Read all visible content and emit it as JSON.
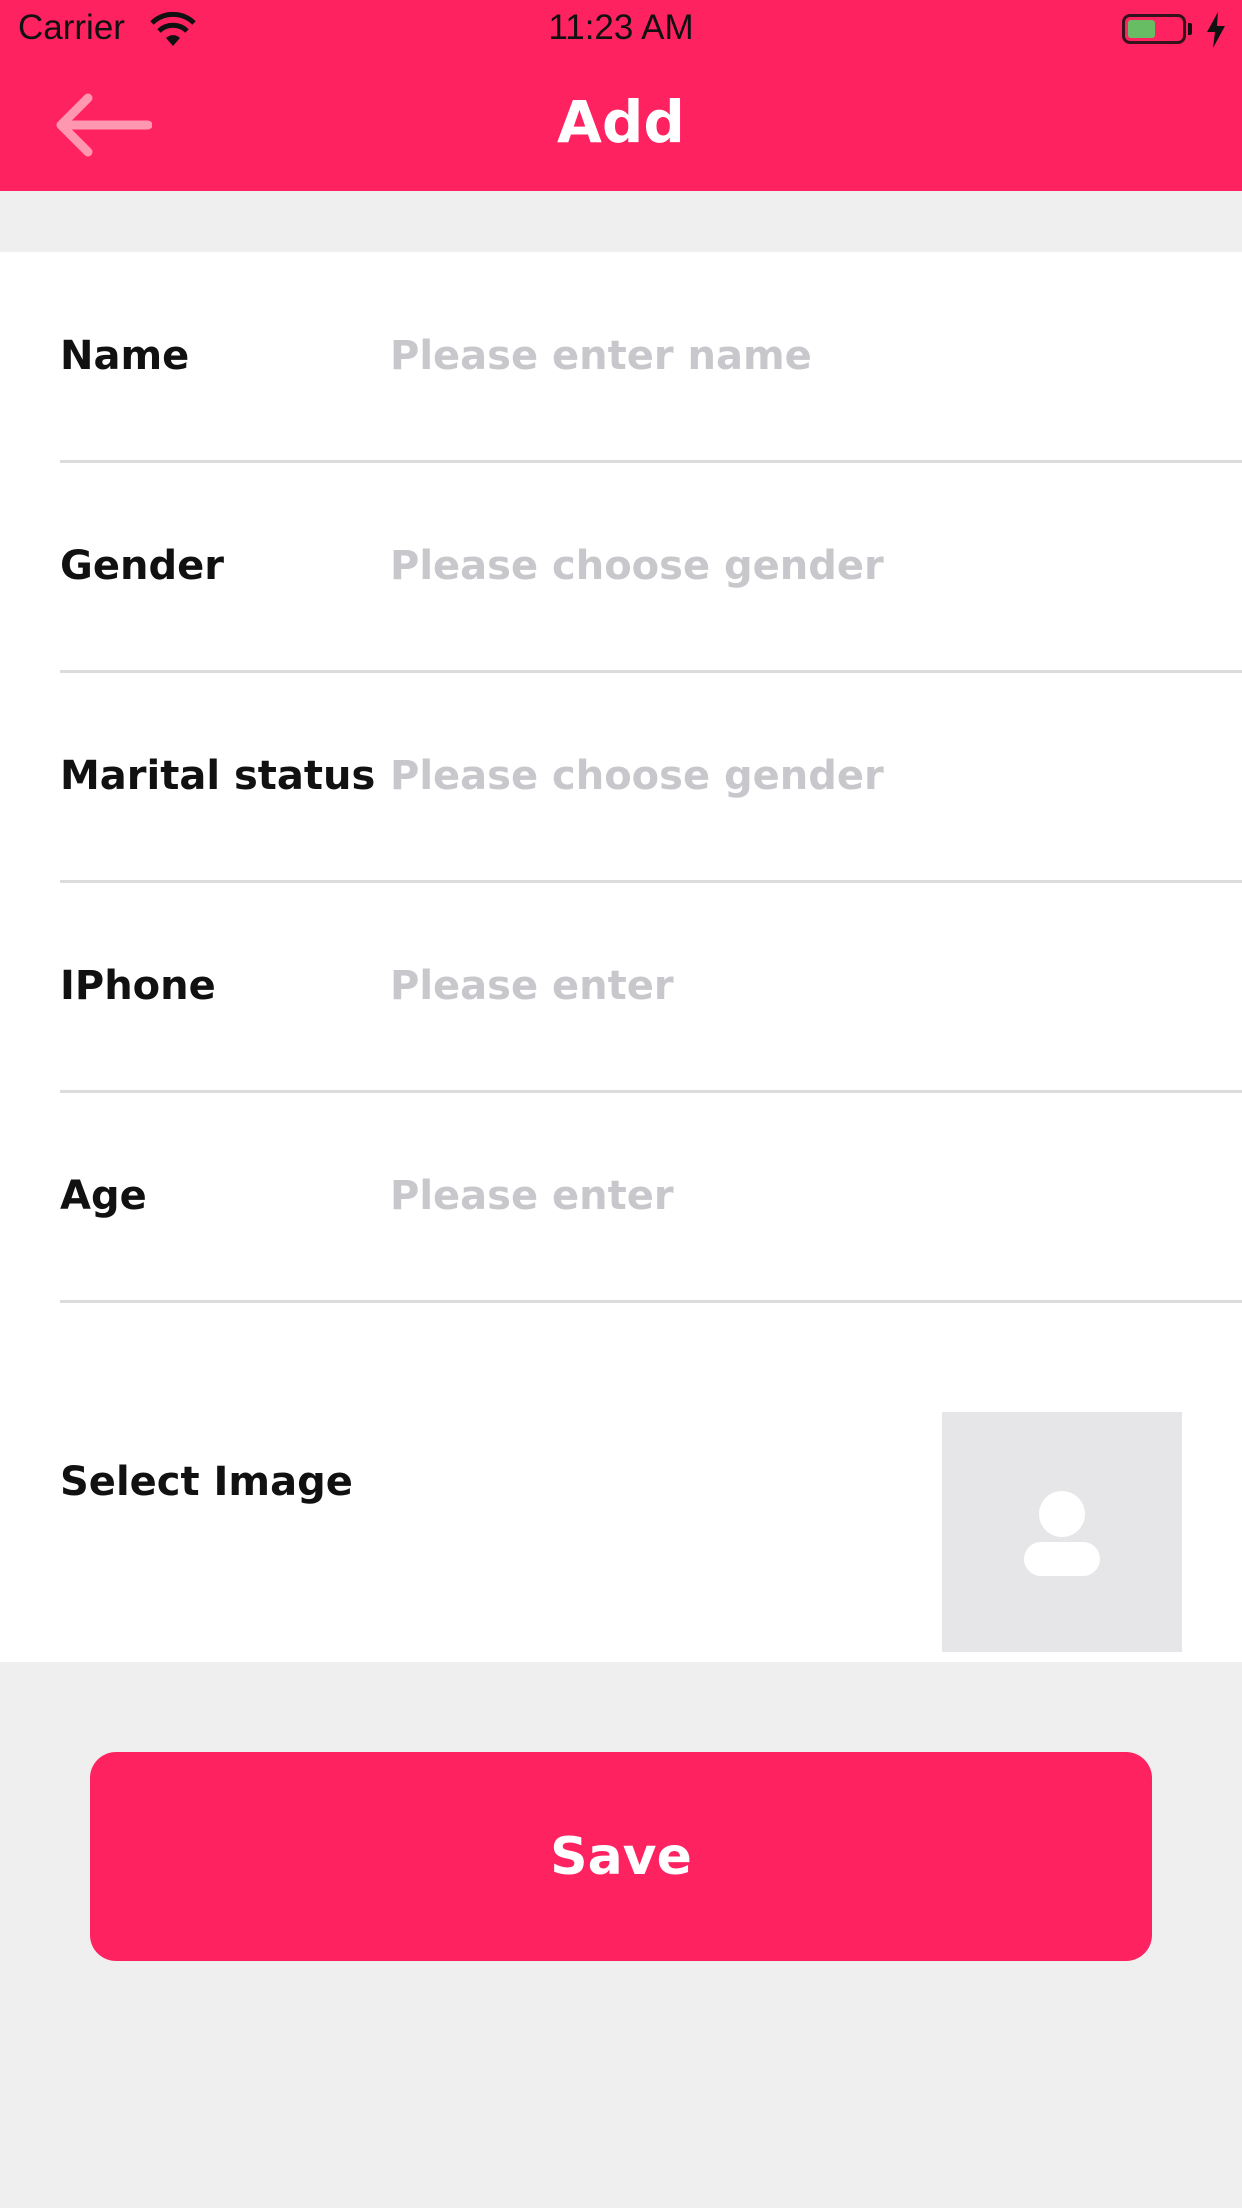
{
  "status_bar": {
    "carrier": "Carrier",
    "time": "11:23 AM",
    "battery_level": 0.46
  },
  "nav": {
    "title": "Add",
    "back_icon": "arrow-left-icon"
  },
  "form": {
    "fields": [
      {
        "label": "Name",
        "placeholder": "Please enter name"
      },
      {
        "label": "Gender",
        "placeholder": "Please choose gender"
      },
      {
        "label": "Marital status",
        "placeholder": "Please choose gender"
      },
      {
        "label": "IPhone",
        "placeholder": "Please enter"
      },
      {
        "label": "Age",
        "placeholder": "Please enter"
      }
    ],
    "image": {
      "label": "Select Image",
      "icon": "person-placeholder-icon"
    }
  },
  "save_label": "Save",
  "colors": {
    "accent": "#ff2261",
    "background": "#efefef",
    "placeholder": "#c7c7cc",
    "battery": "#4cd964"
  }
}
